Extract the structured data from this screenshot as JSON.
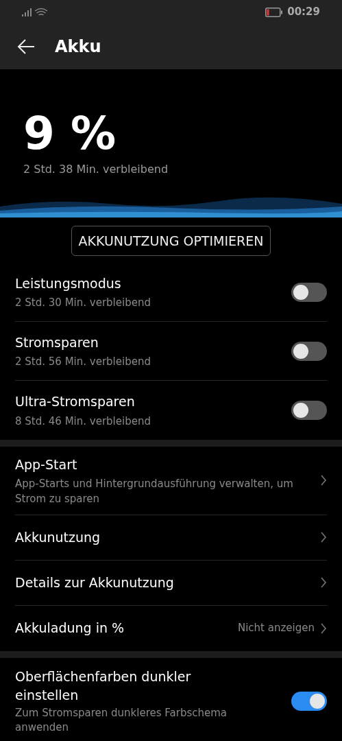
{
  "status_bar": {
    "time": "00:29"
  },
  "header": {
    "title": "Akku"
  },
  "battery": {
    "percent": "9 %",
    "remaining": "2 Std. 38 Min. verbleibend"
  },
  "optimize_button": "AKKUNUTZUNG OPTIMIEREN",
  "modes": [
    {
      "title": "Leistungsmodus",
      "subtitle": "2 Std. 30 Min. verbleibend",
      "on": false
    },
    {
      "title": "Stromsparen",
      "subtitle": "2 Std. 56 Min. verbleibend",
      "on": false
    },
    {
      "title": "Ultra-Stromsparen",
      "subtitle": "8 Std. 46 Min. verbleibend",
      "on": false
    }
  ],
  "links": [
    {
      "title": "App-Start",
      "subtitle": "App-Starts und Hintergrundausführung verwalten, um Strom zu sparen"
    },
    {
      "title": "Akkunutzung"
    },
    {
      "title": "Details zur Akkunutzung"
    },
    {
      "title": "Akkuladung in %",
      "value": "Nicht anzeigen"
    }
  ],
  "dark_mode": {
    "title": "Oberflächenfarben dunkler einstellen",
    "subtitle": "Zum Stromsparen dunkleres Farbschema anwenden",
    "on": true
  }
}
